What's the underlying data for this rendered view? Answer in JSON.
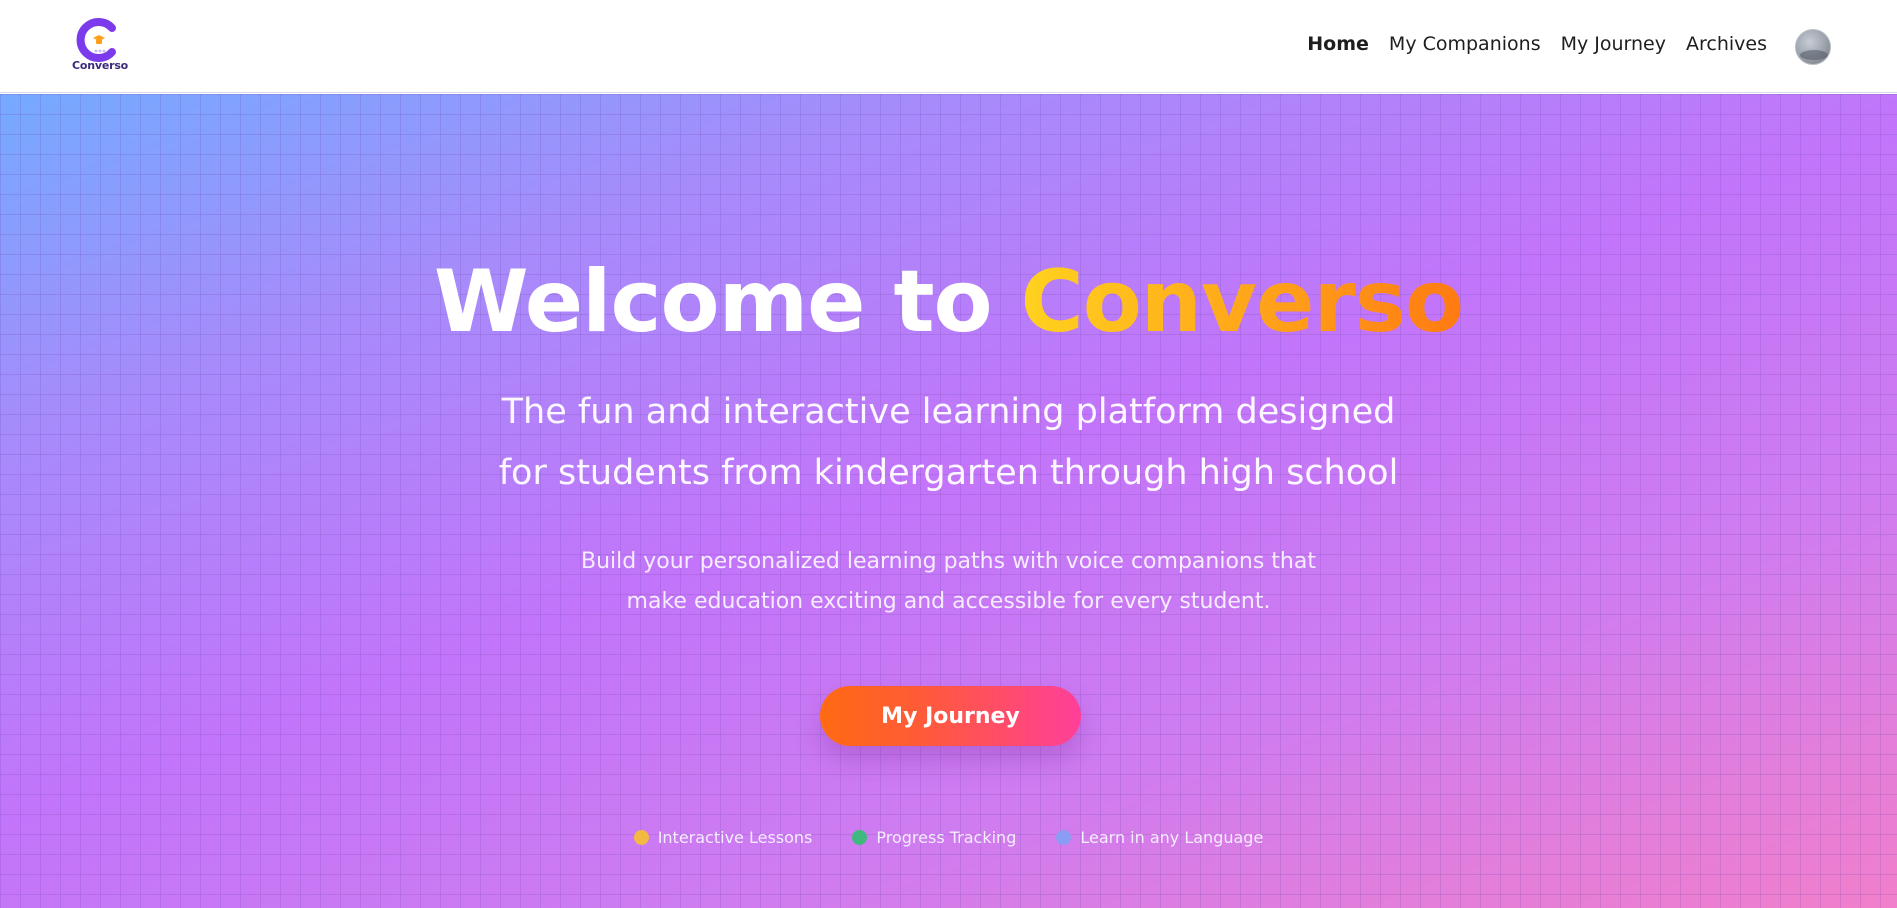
{
  "brand": {
    "logo_text": "Converso",
    "logo_icon": "converso-logo-icon"
  },
  "nav": {
    "items": [
      {
        "label": "Home",
        "active": true
      },
      {
        "label": "My Companions",
        "active": false
      },
      {
        "label": "My Journey",
        "active": false
      },
      {
        "label": "Archives",
        "active": false
      }
    ],
    "avatar_icon": "user-avatar"
  },
  "hero": {
    "title_prefix": "Welcome to ",
    "title_brand": "Converso",
    "subtitle_line1": "The fun and interactive learning platform designed",
    "subtitle_line2": "for students from kindergarten through high school",
    "description_line1": "Build your personalized learning paths with voice companions that",
    "description_line2": "make education exciting and accessible for every student.",
    "cta_label": "My Journey"
  },
  "features": [
    {
      "label": "Interactive Lessons",
      "color": "#f4b942"
    },
    {
      "label": "Progress Tracking",
      "color": "#3fb97d"
    },
    {
      "label": "Learn in any Language",
      "color": "#8c9cf5"
    }
  ],
  "colors": {
    "logo_purple": "#7c3aed",
    "logo_accent": "#ff9f1a",
    "cta_start": "#ff6a12",
    "cta_end": "#ff3f9a",
    "brand_gradient_start": "#ffd21f",
    "brand_gradient_end": "#ff7a12"
  }
}
